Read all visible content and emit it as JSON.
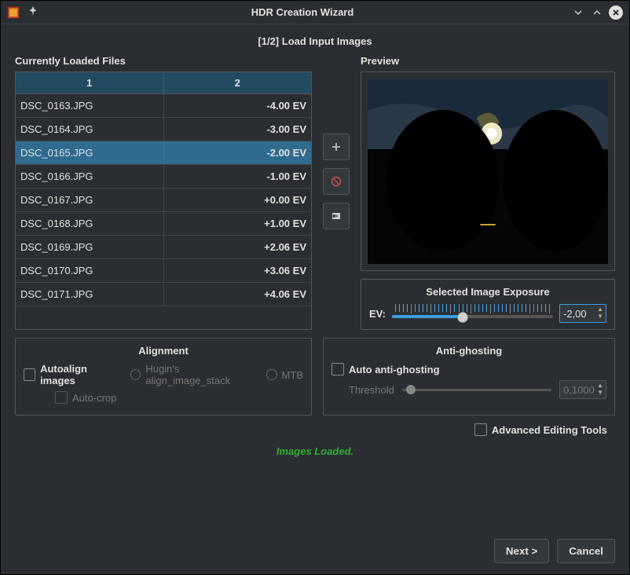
{
  "window": {
    "title": "HDR Creation Wizard"
  },
  "step_title": "[1/2] Load Input Images",
  "files": {
    "section_label": "Currently Loaded Files",
    "col1": "1",
    "col2": "2",
    "selected_index": 2,
    "rows": [
      {
        "name": "DSC_0163.JPG",
        "ev": "-4.00 EV"
      },
      {
        "name": "DSC_0164.JPG",
        "ev": "-3.00 EV"
      },
      {
        "name": "DSC_0165.JPG",
        "ev": "-2.00 EV"
      },
      {
        "name": "DSC_0166.JPG",
        "ev": "-1.00 EV"
      },
      {
        "name": "DSC_0167.JPG",
        "ev": "+0.00 EV"
      },
      {
        "name": "DSC_0168.JPG",
        "ev": "+1.00 EV"
      },
      {
        "name": "DSC_0169.JPG",
        "ev": "+2.06 EV"
      },
      {
        "name": "DSC_0170.JPG",
        "ev": "+3.06 EV"
      },
      {
        "name": "DSC_0171.JPG",
        "ev": "+4.06 EV"
      }
    ]
  },
  "preview": {
    "label": "Preview"
  },
  "exposure": {
    "panel_title": "Selected Image Exposure",
    "ev_label": "EV:",
    "value": "-2,00",
    "fill_percent": 44
  },
  "alignment": {
    "panel_title": "Alignment",
    "autoalign": "Autoalign images",
    "hugin": "Hugin's align_image_stack",
    "mtb": "MTB",
    "autocrop": "Auto-crop"
  },
  "ghosting": {
    "panel_title": "Anti-ghosting",
    "auto": "Auto anti-ghosting",
    "threshold_label": "Threshold",
    "threshold_value": "0,1000"
  },
  "advanced": "Advanced Editing Tools",
  "status": "Images Loaded.",
  "buttons": {
    "next": "Next >",
    "cancel": "Cancel"
  }
}
